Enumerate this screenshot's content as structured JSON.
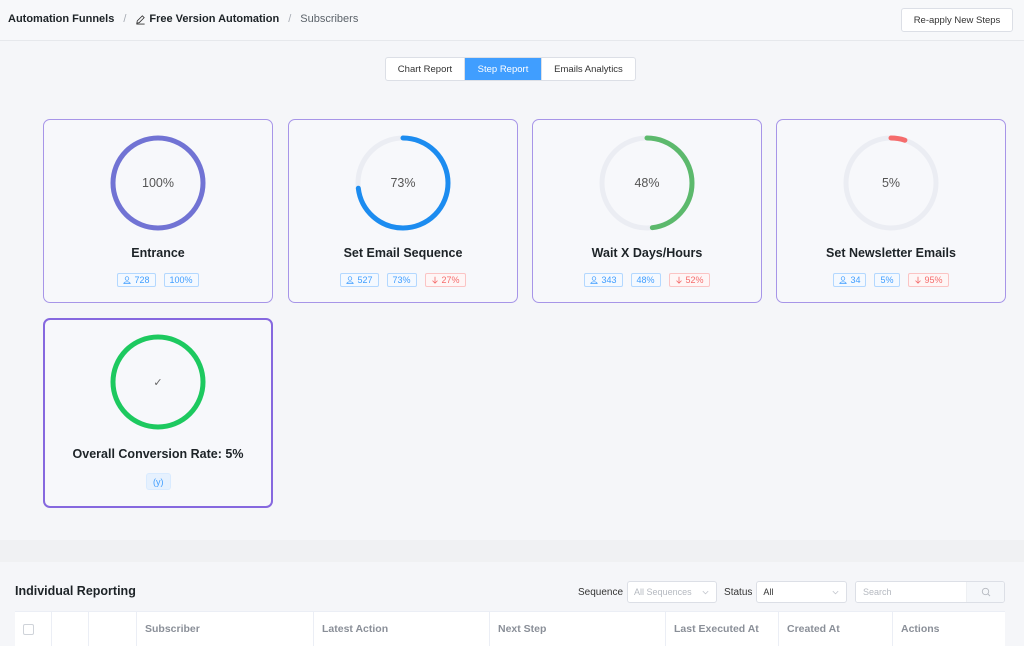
{
  "breadcrumb": {
    "items": [
      "Automation Funnels",
      "Free Version Automation",
      "Subscribers"
    ],
    "separator": "/"
  },
  "header": {
    "reapply_label": "Re-apply New Steps"
  },
  "tabs": [
    {
      "label": "Chart Report",
      "active": false
    },
    {
      "label": "Step Report",
      "active": true
    },
    {
      "label": "Emails Analytics",
      "active": false
    }
  ],
  "steps": [
    {
      "title": "Entrance",
      "percent": 100,
      "percent_label": "100%",
      "count": "728",
      "rate": "100%",
      "drop": null,
      "color": "#7173d4"
    },
    {
      "title": "Set Email Sequence",
      "percent": 73,
      "percent_label": "73%",
      "count": "527",
      "rate": "73%",
      "drop": "27%",
      "color": "#1c8cf0"
    },
    {
      "title": "Wait X Days/Hours",
      "percent": 48,
      "percent_label": "48%",
      "count": "343",
      "rate": "48%",
      "drop": "52%",
      "color": "#5cb96c"
    },
    {
      "title": "Set Newsletter Emails",
      "percent": 5,
      "percent_label": "5%",
      "count": "34",
      "rate": "5%",
      "drop": "95%",
      "color": "#f56c6c"
    }
  ],
  "conversion": {
    "title": "Overall Conversion Rate: 5%",
    "badge": "(y)",
    "color": "#1dc95f",
    "check": "✓"
  },
  "individual": {
    "title": "Individual Reporting",
    "sequence_label": "Sequence",
    "sequence_placeholder": "All Sequences",
    "status_label": "Status",
    "status_value": "All",
    "search_placeholder": "Search",
    "columns": [
      "",
      "",
      "",
      "Subscriber",
      "Latest Action",
      "Next Step",
      "Last Executed At",
      "Created At",
      "Actions"
    ]
  }
}
